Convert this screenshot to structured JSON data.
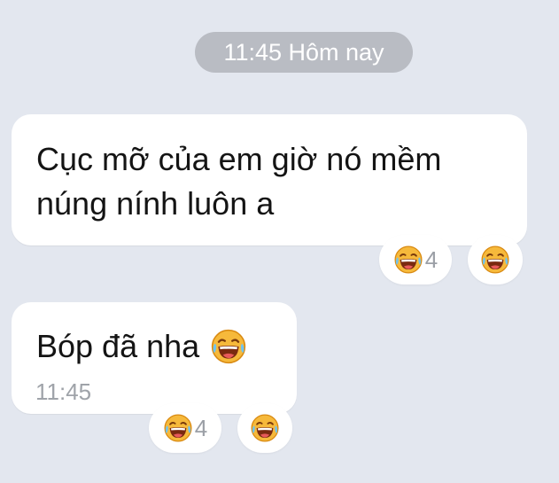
{
  "timestamp_pill": "11:45 Hôm nay",
  "messages": [
    {
      "lines": [
        "Cục mỡ của em giờ nó mềm",
        "núng nính luôn a"
      ],
      "reaction_count": "4",
      "reaction_icon": "laughing-tears-icon"
    },
    {
      "text": "Bóp đã nha",
      "time": "11:45",
      "reaction_count": "4",
      "reaction_icon": "laughing-tears-icon"
    }
  ],
  "colors": {
    "background": "#e3e7ef",
    "pill": "#b9bcc3",
    "bubble": "#ffffff",
    "emoji_face": "#f5b82e"
  }
}
